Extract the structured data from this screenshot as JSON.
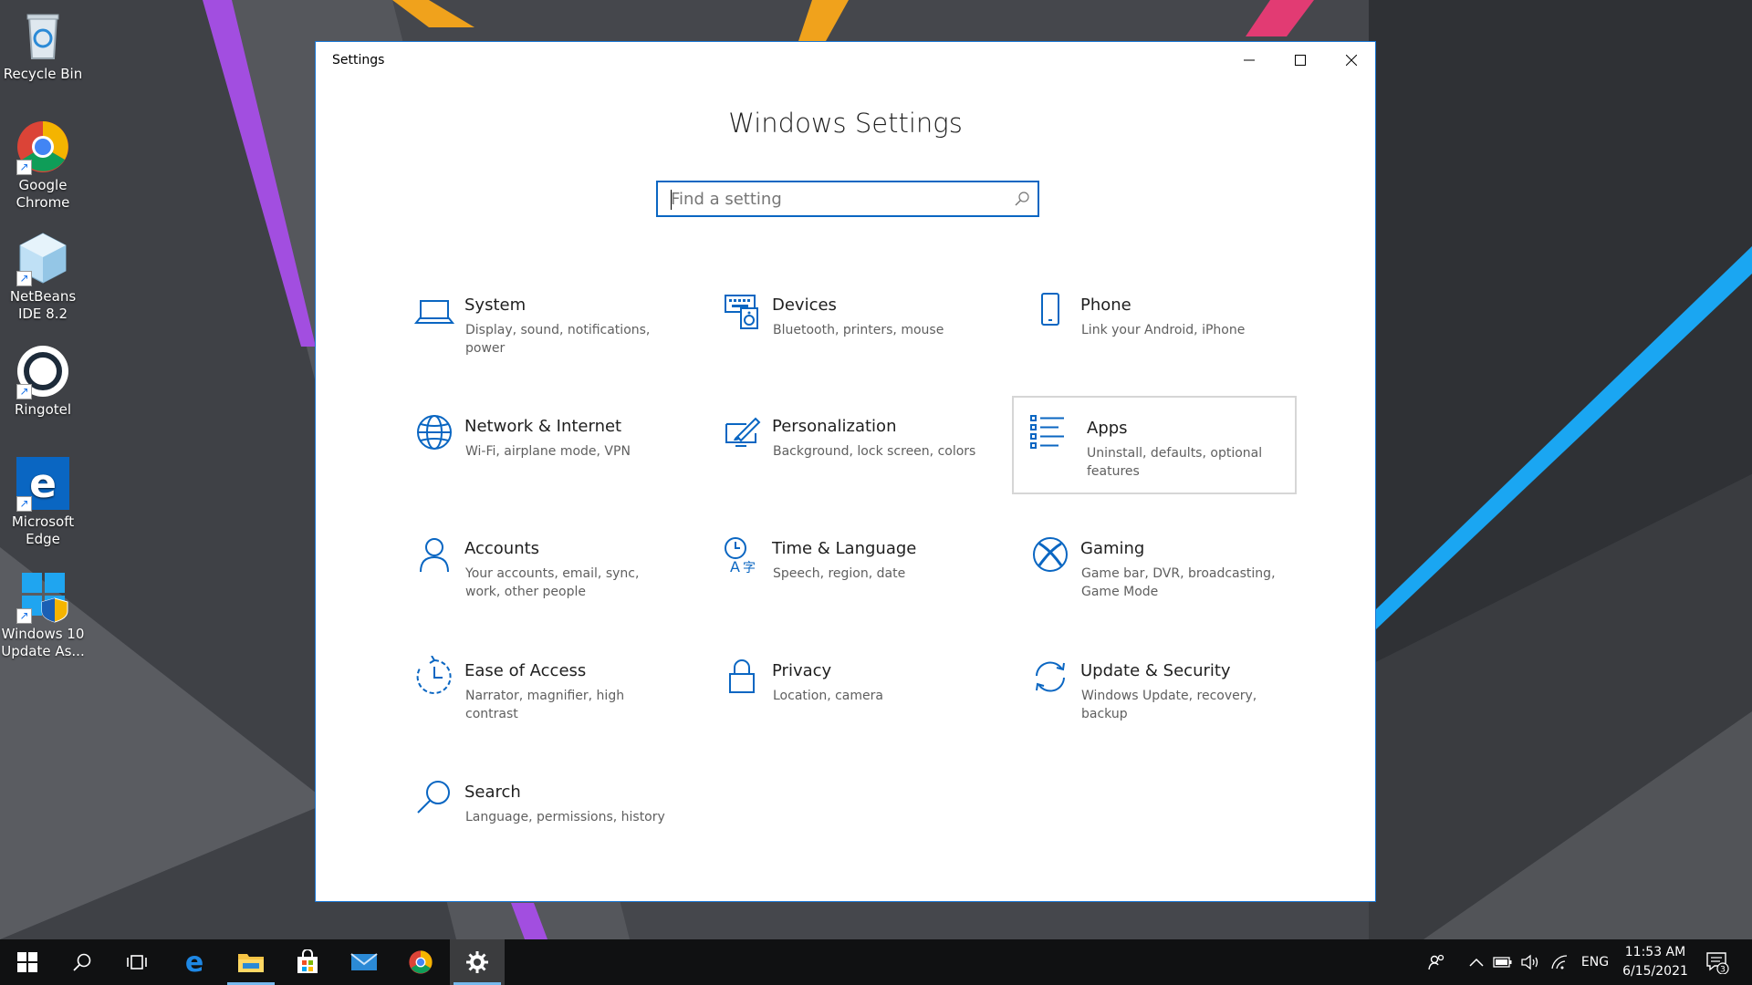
{
  "desktop": {
    "icons": [
      {
        "label": "Recycle Bin",
        "icon": "recycle-bin-icon"
      },
      {
        "label": "Google Chrome",
        "icon": "chrome-icon"
      },
      {
        "label": "NetBeans IDE 8.2",
        "icon": "netbeans-icon"
      },
      {
        "label": "Ringotel",
        "icon": "ringotel-icon"
      },
      {
        "label": "Microsoft Edge",
        "icon": "edge-icon"
      },
      {
        "label": "Windows 10 Update As...",
        "icon": "windows-update-assistant-icon"
      }
    ]
  },
  "window": {
    "title": "Settings",
    "controls": [
      "minimize",
      "maximize",
      "close"
    ],
    "heading": "Windows Settings",
    "search": {
      "placeholder": "Find a setting",
      "value": ""
    },
    "categories": [
      {
        "title": "System",
        "desc": "Display, sound, notifications, power",
        "icon": "laptop-icon"
      },
      {
        "title": "Devices",
        "desc": "Bluetooth, printers, mouse",
        "icon": "keyboard-speaker-icon"
      },
      {
        "title": "Phone",
        "desc": "Link your Android, iPhone",
        "icon": "phone-icon"
      },
      {
        "title": "Network & Internet",
        "desc": "Wi-Fi, airplane mode, VPN",
        "icon": "globe-icon"
      },
      {
        "title": "Personalization",
        "desc": "Background, lock screen, colors",
        "icon": "paintbrush-icon"
      },
      {
        "title": "Apps",
        "desc": "Uninstall, defaults, optional features",
        "icon": "apps-list-icon",
        "hovered": true
      },
      {
        "title": "Accounts",
        "desc": "Your accounts, email, sync, work, other people",
        "icon": "person-icon"
      },
      {
        "title": "Time & Language",
        "desc": "Speech, region, date",
        "icon": "time-language-icon"
      },
      {
        "title": "Gaming",
        "desc": "Game bar, DVR, broadcasting, Game Mode",
        "icon": "xbox-icon"
      },
      {
        "title": "Ease of Access",
        "desc": "Narrator, magnifier, high contrast",
        "icon": "ease-of-access-icon"
      },
      {
        "title": "Privacy",
        "desc": "Location, camera",
        "icon": "lock-icon"
      },
      {
        "title": "Update & Security",
        "desc": "Windows Update, recovery, backup",
        "icon": "sync-arrows-icon"
      },
      {
        "title": "Search",
        "desc": "Language, permissions, history",
        "icon": "magnifier-icon"
      }
    ]
  },
  "taskbar": {
    "buttons": [
      "start",
      "search",
      "task-view",
      "edge",
      "file-explorer",
      "store",
      "mail",
      "chrome",
      "settings"
    ],
    "active": "settings",
    "tray": {
      "language": "ENG",
      "time": "11:53 AM",
      "date": "6/15/2021",
      "notification_count": "3"
    }
  },
  "colors": {
    "accent": "#0a66c2",
    "icon_blue": "#0a66c2",
    "taskbar": "#101112"
  }
}
